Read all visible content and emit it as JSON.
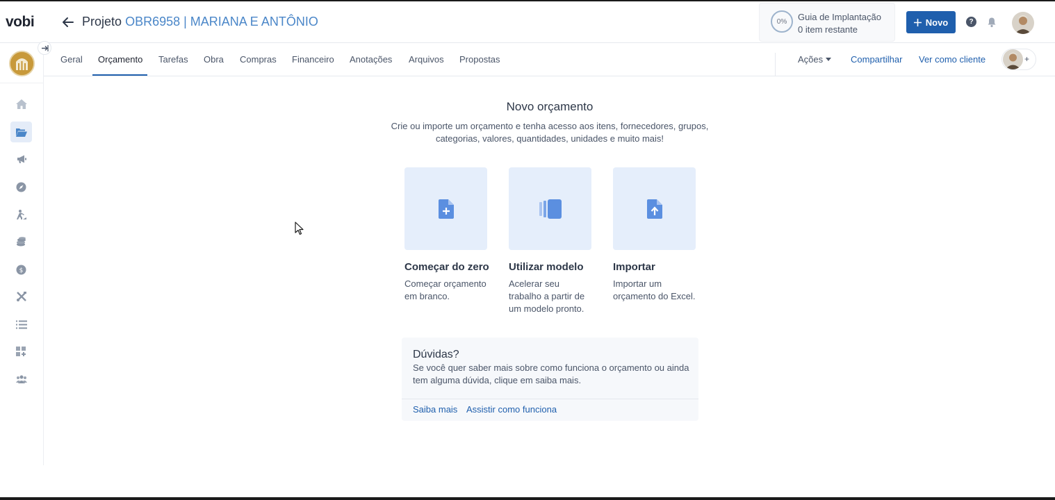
{
  "app": {
    "logo": "vobi"
  },
  "header": {
    "project_prefix": "Projeto",
    "project_code": "OBR6958 | MARIANA E ANTÔNIO",
    "guide": {
      "progress": "0%",
      "title": "Guia de Implantação",
      "subtitle": "0 item restante"
    },
    "novo_label": "Novo",
    "help_glyph": "?"
  },
  "tabs": [
    {
      "label": "Geral"
    },
    {
      "label": "Orçamento",
      "active": true
    },
    {
      "label": "Tarefas"
    },
    {
      "label": "Obra"
    },
    {
      "label": "Compras"
    },
    {
      "label": "Financeiro"
    },
    {
      "label": "Anotações"
    },
    {
      "label": "Arquivos"
    },
    {
      "label": "Propostas"
    }
  ],
  "actions": {
    "acoes": "Ações",
    "share": "Compartilhar",
    "client_view": "Ver como cliente",
    "add_glyph": "+"
  },
  "sidebar": {
    "icons": [
      "home-icon",
      "folder-open-icon",
      "megaphone-icon",
      "compass-icon",
      "rocket-icon",
      "coins-icon",
      "dollar-icon",
      "tools-icon",
      "list-icon",
      "grid-plus-icon",
      "users-icon"
    ]
  },
  "main": {
    "title": "Novo orçamento",
    "subtitle": "Crie ou importe um orçamento e tenha acesso aos itens, fornecedores, grupos, categorias, valores, quantidades, unidades e muito mais!",
    "options": [
      {
        "title": "Começar do zero",
        "desc": "Começar orçamento em branco.",
        "icon": "file-plus-icon"
      },
      {
        "title": "Utilizar modelo",
        "desc": "Acelerar seu trabalho a partir de um modelo pronto.",
        "icon": "template-icon"
      },
      {
        "title": "Importar",
        "desc": "Importar um orçamento do Excel.",
        "icon": "file-upload-icon"
      }
    ],
    "help": {
      "title": "Dúvidas?",
      "text": "Se você quer saber mais sobre como funciona o orçamento ou ainda tem alguma dúvida, clique em saiba mais.",
      "link1": "Saiba mais",
      "link2": "Assistir como funciona"
    }
  },
  "colors": {
    "primary": "#1f5fad",
    "link": "#4a86c8",
    "card": "#e5eefb",
    "icon": "#5b8fe0"
  }
}
